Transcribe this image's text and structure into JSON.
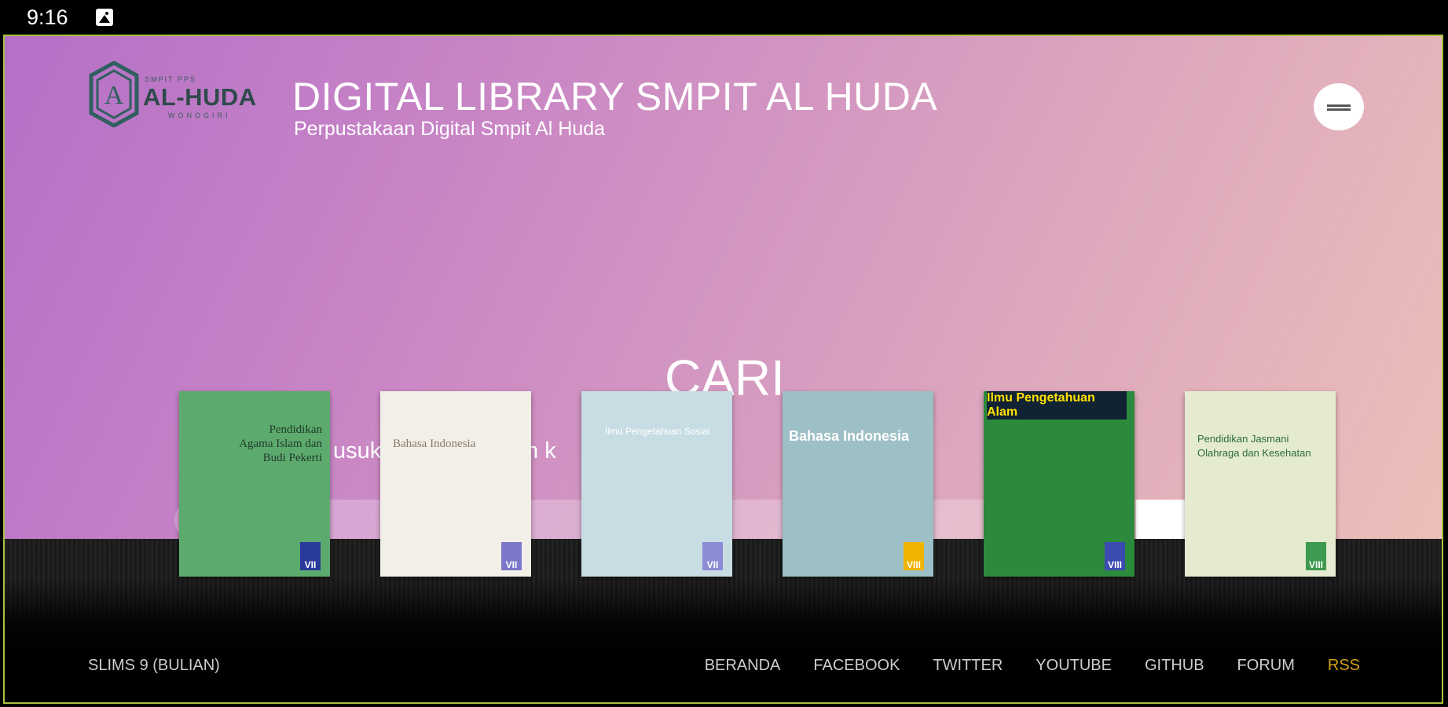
{
  "status_bar": {
    "time": "9:16"
  },
  "header": {
    "logo": {
      "small_text": "SMPIT PPS",
      "name": "AL-HUDA",
      "sub_text": "WONOGIRI"
    },
    "title": "DIGITAL LIBRARY SMPIT AL HUDA",
    "subtitle": "Perpustakaan Digital Smpit Al Huda"
  },
  "hero": {
    "heading": "CARI",
    "tagline_visible": "usukl          u leb               dan        aran          k"
  },
  "books": [
    {
      "title": "Pendidikan Agama Islam dan Budi Pekerti",
      "grade": "VII",
      "color": "#5daa6e"
    },
    {
      "title": "Bahasa Indonesia",
      "grade": "VII",
      "color": "#f1efe8"
    },
    {
      "title": "Ilmu Pengetahuan Sosial",
      "grade": "VII",
      "color": "#c7dde3"
    },
    {
      "title": "Bahasa Indonesia",
      "grade": "VIII",
      "color": "#9dbfc6"
    },
    {
      "title": "Ilmu Pengetahuan Alam",
      "grade": "VIII",
      "color": "#2c8a3c"
    },
    {
      "title": "Pendidikan Jasmani Olahraga dan Kesehatan",
      "grade": "VIII",
      "color": "#e4ebd0"
    }
  ],
  "footer": {
    "version": "SLIMS 9 (BULIAN)",
    "links": [
      "BERANDA",
      "FACEBOOK",
      "TWITTER",
      "YOUTUBE",
      "GITHUB",
      "FORUM",
      "RSS"
    ]
  }
}
